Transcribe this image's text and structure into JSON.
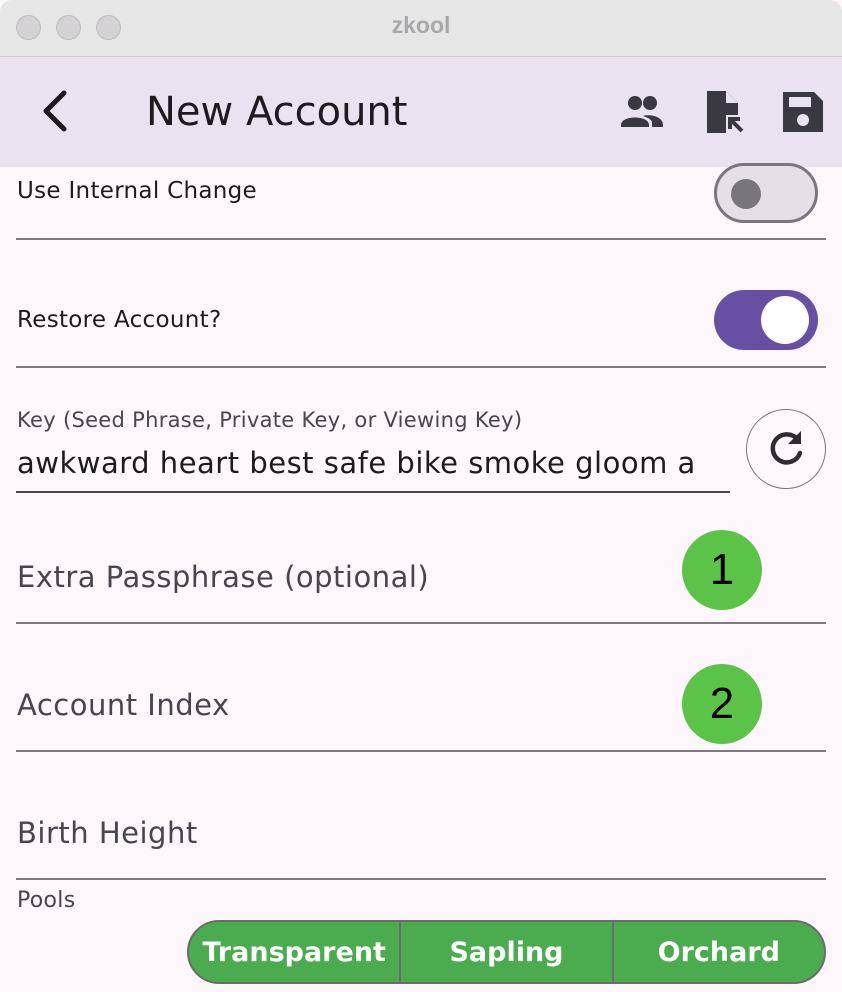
{
  "window": {
    "title": "zkool"
  },
  "appbar": {
    "title": "New Account",
    "actions": [
      "people-icon",
      "file-import-icon",
      "save-icon"
    ]
  },
  "form": {
    "internal_change": {
      "label": "Use Internal Change",
      "on": false
    },
    "restore": {
      "label": "Restore Account?",
      "on": true
    },
    "key": {
      "label": "Key (Seed Phrase, Private Key, or Viewing Key)",
      "value": "awkward heart best safe bike smoke gloom a"
    },
    "passphrase": {
      "placeholder": "Extra Passphrase (optional)",
      "marker": "1"
    },
    "account_index": {
      "placeholder": "Account Index",
      "marker": "2"
    },
    "birth_height": {
      "placeholder": "Birth Height"
    },
    "pools": {
      "label": "Pools",
      "options": [
        "Transparent",
        "Sapling",
        "Orchard"
      ],
      "selected": [
        "Transparent",
        "Sapling",
        "Orchard"
      ]
    }
  },
  "colors": {
    "accent": "#6750a4",
    "pool_selected": "#4aab4f",
    "marker": "#5cc349",
    "appbar": "#e9e2f0"
  }
}
